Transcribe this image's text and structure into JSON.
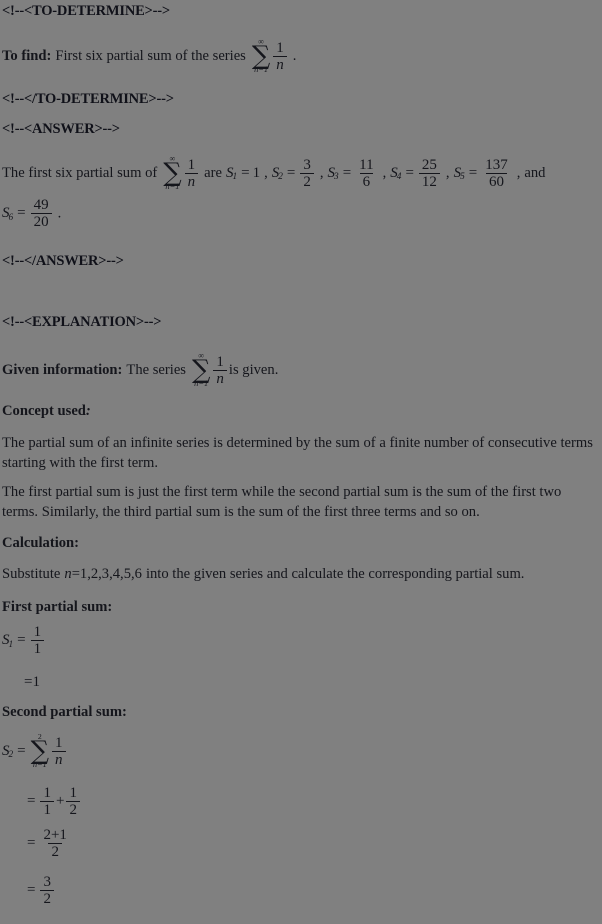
{
  "document": {
    "background_color": "#808080",
    "text_color": "#15161c"
  },
  "comments": {
    "to_determine_open": "<!--<TO-DETERMINE>-->",
    "to_determine_close": "<!--</TO-DETERMINE>-->",
    "answer_open": "<!--<ANSWER>-->",
    "answer_close": "<!--</ANSWER>-->",
    "explanation_open": "<!--<EXPLANATION>-->"
  },
  "to_find": {
    "label": "To find:",
    "text": "First six partial sum of the series",
    "series": {
      "sum_top": "∞",
      "sum_bottom": "n=1",
      "numerator": "1",
      "denominator": "n"
    },
    "period": "."
  },
  "answer": {
    "lead": "The first six partial sum of",
    "series": {
      "sum_top": "∞",
      "sum_bottom": "n=1",
      "numerator": "1",
      "denominator": "n"
    },
    "are": "are",
    "terms": [
      {
        "name": "S",
        "index": "1",
        "eq": "=",
        "value": "1",
        "sep": ","
      },
      {
        "name": "S",
        "index": "2",
        "eq": "=",
        "num": "3",
        "den": "2",
        "sep": ","
      },
      {
        "name": "S",
        "index": "3",
        "eq": "=",
        "num": "11",
        "den": "6",
        "sep": ","
      },
      {
        "name": "S",
        "index": "4",
        "eq": "=",
        "num": "25",
        "den": "12",
        "sep": ","
      },
      {
        "name": "S",
        "index": "5",
        "eq": "=",
        "num": "137",
        "den": "60",
        "sep": ","
      }
    ],
    "and": "and",
    "last_term": {
      "name": "S",
      "index": "6",
      "eq": "=",
      "num": "49",
      "den": "20",
      "period": "."
    }
  },
  "given_information": {
    "label": "Given information:",
    "text_before": "The series",
    "series": {
      "sum_top": "∞",
      "sum_bottom": "n=1",
      "numerator": "1",
      "denominator": "n"
    },
    "text_after": "is given."
  },
  "concept_used": {
    "label": "Concept used",
    "label_colon": ":",
    "paragraph1": "The partial sum of an infinite series is determined by the sum of a finite number of consecutive terms starting with the first term.",
    "paragraph2": "The first partial sum is just the first term while the second partial sum is the sum of the first two terms. Similarly, the third partial sum is the sum of the first three terms and so on."
  },
  "calculation": {
    "label": "Calculation:",
    "instruction_before": "Substitute",
    "variable": "n",
    "equals_values": "=1,2,3,4,5,6",
    "instruction_after": "into the given series and calculate the corresponding partial sum."
  },
  "first_partial_sum": {
    "heading": "First partial sum:",
    "line1": {
      "name": "S",
      "index": "1",
      "eq": "=",
      "num": "1",
      "den": "1"
    },
    "line2": {
      "eq": "=",
      "value": "1"
    }
  },
  "second_partial_sum": {
    "heading": "Second partial sum:",
    "line1": {
      "name": "S",
      "index": "2",
      "eq": "=",
      "sum_top": "2",
      "sum_bottom": "n=1",
      "numerator": "1",
      "denominator": "n"
    },
    "line2": {
      "eq": "=",
      "num1": "1",
      "den1": "1",
      "plus": "+",
      "num2": "1",
      "den2": "2"
    },
    "line3": {
      "eq": "=",
      "num": "2+1",
      "den": "2"
    },
    "line4": {
      "eq": "=",
      "num": "3",
      "den": "2"
    }
  }
}
